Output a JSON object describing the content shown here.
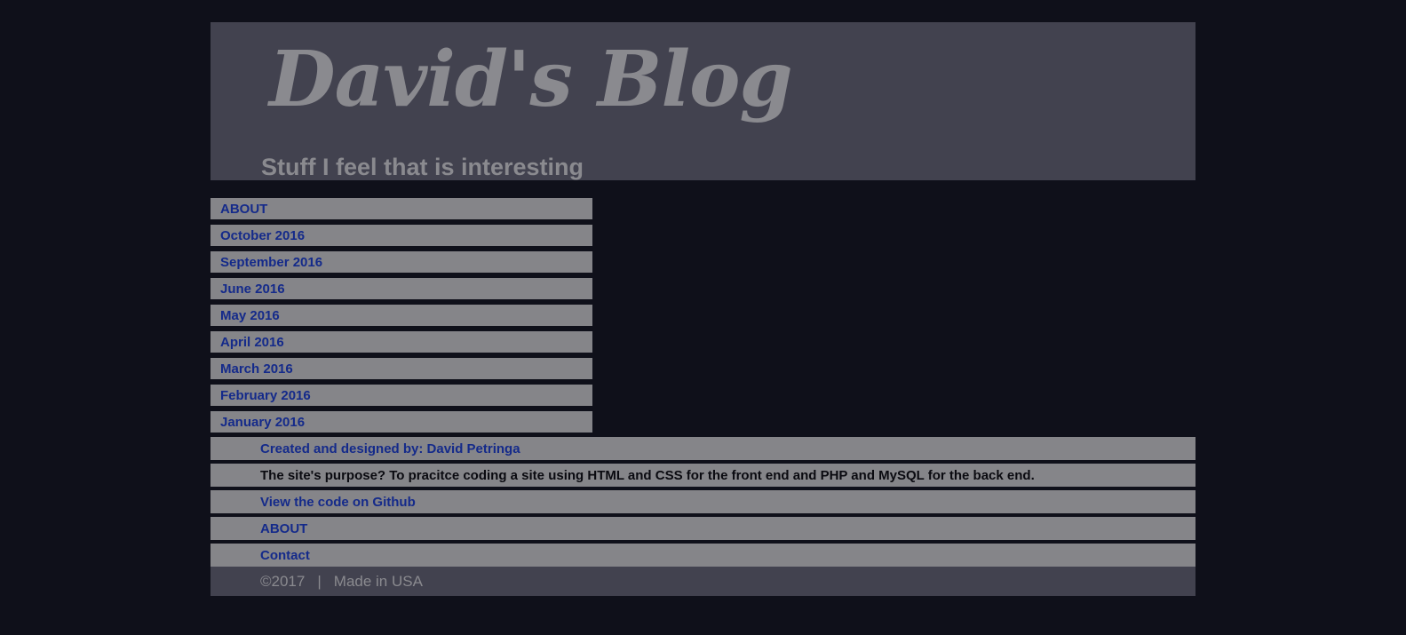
{
  "header": {
    "title": "David's Blog",
    "subtitle": "Stuff I feel that is interesting"
  },
  "nav": {
    "items": [
      {
        "label": "ABOUT"
      },
      {
        "label": "October 2016"
      },
      {
        "label": "September 2016"
      },
      {
        "label": "June 2016"
      },
      {
        "label": "May 2016"
      },
      {
        "label": "April 2016"
      },
      {
        "label": "March 2016"
      },
      {
        "label": "February 2016"
      },
      {
        "label": "January 2016"
      }
    ]
  },
  "footer": {
    "credit": "Created and designed by: David Petringa",
    "purpose": "The site's purpose? To pracitce coding a site using HTML and CSS for the front end and PHP and MySQL for the back end.",
    "github": "View the code on Github",
    "about": "ABOUT",
    "contact": "Contact",
    "copyright": "©2017",
    "separator": "|",
    "made_in": "Made in USA"
  },
  "colors": {
    "background": "#0f101a",
    "panel": "#42424f",
    "bar": "#858589",
    "link": "#142a8a",
    "muted_text": "#8a8a8f"
  }
}
